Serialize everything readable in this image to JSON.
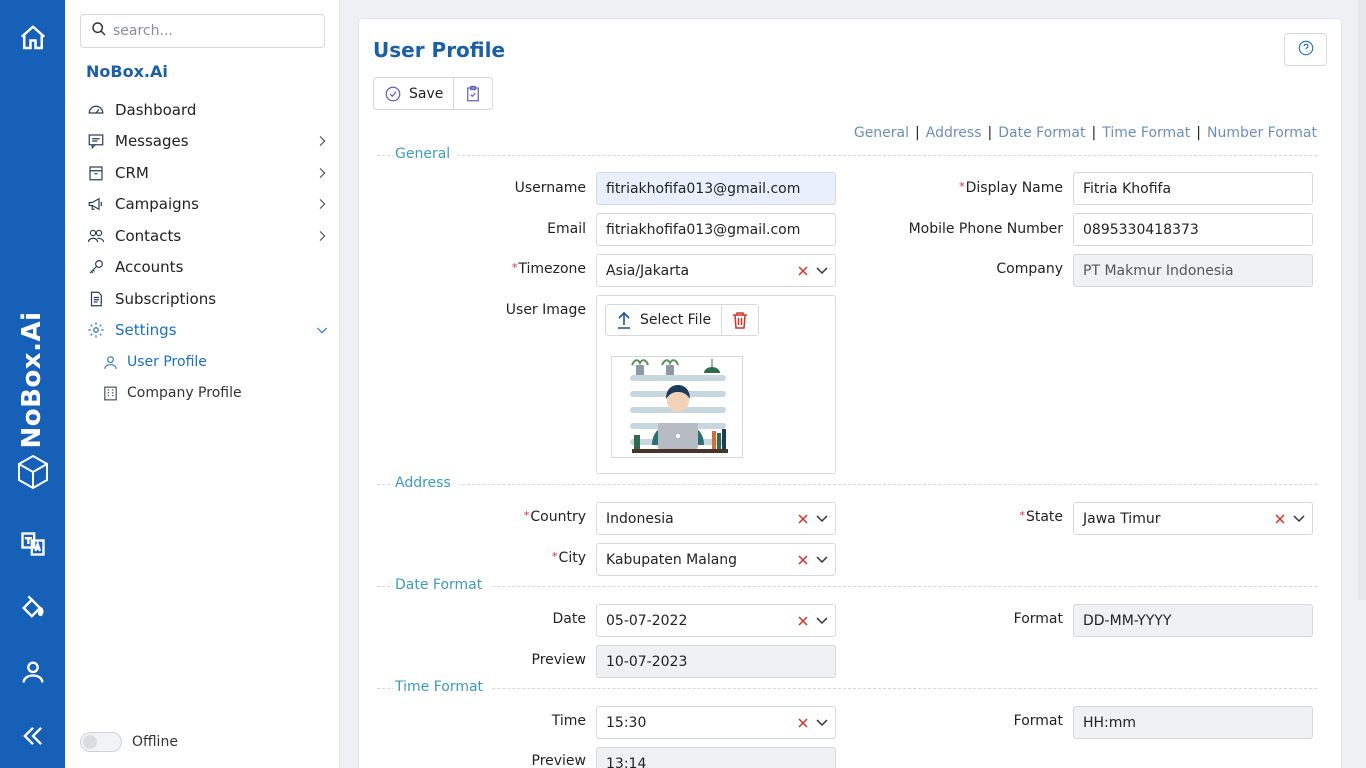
{
  "rail": {
    "brand": "NoBox.Ai"
  },
  "nav": {
    "search_placeholder": "search...",
    "brand": "NoBox.Ai",
    "items": [
      {
        "label": "Dashboard",
        "icon": "gauge-icon",
        "has_chevron": false
      },
      {
        "label": "Messages",
        "icon": "message-icon",
        "has_chevron": true
      },
      {
        "label": "CRM",
        "icon": "box-icon",
        "has_chevron": true
      },
      {
        "label": "Campaigns",
        "icon": "megaphone-icon",
        "has_chevron": true
      },
      {
        "label": "Contacts",
        "icon": "users-icon",
        "has_chevron": true
      },
      {
        "label": "Accounts",
        "icon": "key-icon",
        "has_chevron": false
      },
      {
        "label": "Subscriptions",
        "icon": "document-icon",
        "has_chevron": false
      },
      {
        "label": "Settings",
        "icon": "gear-icon",
        "has_chevron": true,
        "expanded": true
      }
    ],
    "sub_items": [
      {
        "label": "User Profile",
        "icon": "user-icon",
        "active": true
      },
      {
        "label": "Company Profile",
        "icon": "building-icon",
        "active": false
      }
    ],
    "status_label": "Offline"
  },
  "page": {
    "title": "User Profile",
    "save_label": "Save",
    "anchors": [
      "General",
      "Address",
      "Date Format",
      "Time Format",
      "Number Format"
    ]
  },
  "general": {
    "section": "General",
    "username_label": "Username",
    "username_value": "fitriakhofifa013@gmail.com",
    "email_label": "Email",
    "email_value": "fitriakhofifa013@gmail.com",
    "timezone_label": "Timezone",
    "timezone_value": "Asia/Jakarta",
    "user_image_label": "User Image",
    "select_file_label": "Select File",
    "display_name_label": "Display Name",
    "display_name_value": "Fitria Khofifa",
    "mobile_label": "Mobile Phone Number",
    "mobile_value": "0895330418373",
    "company_label": "Company",
    "company_value": "PT Makmur Indonesia"
  },
  "address": {
    "section": "Address",
    "country_label": "Country",
    "country_value": "Indonesia",
    "state_label": "State",
    "state_value": "Jawa Timur",
    "city_label": "City",
    "city_value": "Kabupaten Malang"
  },
  "date_format": {
    "section": "Date Format",
    "date_label": "Date",
    "date_value": "05-07-2022",
    "format_label": "Format",
    "format_value": "DD-MM-YYYY",
    "preview_label": "Preview",
    "preview_value": "10-07-2023"
  },
  "time_format": {
    "section": "Time Format",
    "time_label": "Time",
    "time_value": "15:30",
    "format_label": "Format",
    "format_value": "HH:mm",
    "preview_label": "Preview",
    "preview_value": "13:14"
  },
  "colors": {
    "rail": "#1760b8",
    "accent": "#1a6fc2",
    "section": "#3a9bbf",
    "required": "#d93025"
  }
}
